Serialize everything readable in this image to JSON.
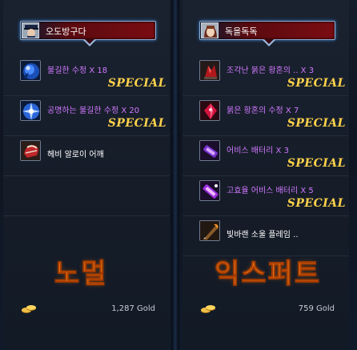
{
  "left": {
    "player_name": "오도방구다",
    "items": [
      {
        "name": "불길한 수정 X 18",
        "tag": "SPECIAL",
        "icon": "blue-crystal-icon"
      },
      {
        "name": "공명하는 불길한 수정 X 20",
        "tag": "SPECIAL",
        "icon": "blue-crystal-burst-icon"
      },
      {
        "name": "헤비 알로이 어깨",
        "tag": "",
        "icon": "red-shoulder-armor-icon"
      }
    ],
    "difficulty_label": "노멀",
    "gold": "1,287 Gold"
  },
  "right": {
    "player_name": "독을독독",
    "items": [
      {
        "name": "조각난 붉은 황혼의 .. X 3",
        "tag": "SPECIAL",
        "icon": "red-shard-icon"
      },
      {
        "name": "붉은 황혼의 수정 X 7",
        "tag": "SPECIAL",
        "icon": "red-crystal-icon"
      },
      {
        "name": "어비스 배터리 X 3",
        "tag": "SPECIAL",
        "icon": "purple-battery-icon"
      },
      {
        "name": "고효율 어비스 배터리 X 5",
        "tag": "SPECIAL",
        "icon": "purple-battery-hq-icon"
      },
      {
        "name": "빛바랜 소울 플레임 ..",
        "tag": "",
        "icon": "soul-flame-weapon-icon"
      }
    ],
    "difficulty_label": "익스퍼트",
    "gold": "759 Gold"
  }
}
